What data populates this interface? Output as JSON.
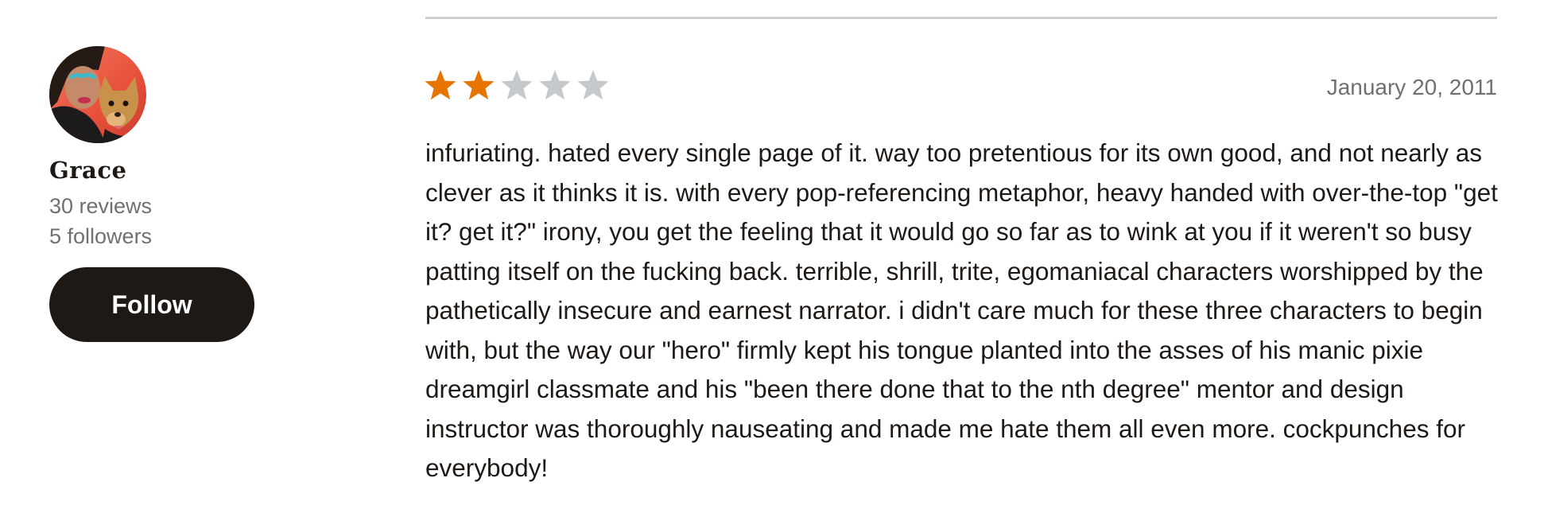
{
  "reviewer": {
    "name": "Grace",
    "reviews_label": "30 reviews",
    "followers_label": "5 followers",
    "follow_label": "Follow"
  },
  "review": {
    "rating": 2,
    "max_rating": 5,
    "date": "January 20, 2011",
    "text": "infuriating. hated every single page of it. way too pretentious for its own good, and not nearly as clever as it thinks it is. with every pop-referencing metaphor, heavy handed with over-the-top \"get it? get it?\" irony, you get the feeling that it would go so far as to wink at you if it weren't so busy patting itself on the fucking back. terrible, shrill, trite, egomaniacal characters worshipped by the pathetically insecure and earnest narrator. i didn't care much for these three characters to begin with, but the way our \"hero\" firmly kept his tongue planted into the asses of his manic pixie dreamgirl classmate and his \"been there done that to the nth degree\" mentor and design instructor was thoroughly nauseating and made me hate them all even more. cockpunches for everybody!"
  },
  "colors": {
    "star_filled": "#e87400",
    "star_empty": "#c5c9cc",
    "button_bg": "#1e1915",
    "divider": "#cfcfcf"
  },
  "icons": {
    "avatar": "user-avatar-photo",
    "star": "star-icon"
  }
}
